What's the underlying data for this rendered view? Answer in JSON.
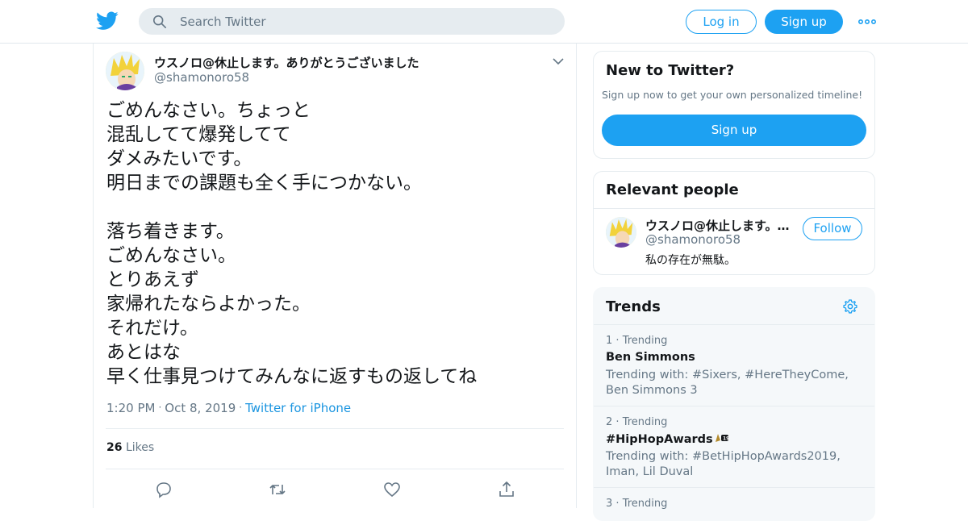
{
  "header": {
    "search_placeholder": "Search Twitter",
    "login_label": "Log in",
    "signup_label": "Sign up",
    "icons": [
      "twitter-logo-icon",
      "search-icon",
      "more-icon"
    ],
    "accent_color": "#1da1f2"
  },
  "tweet": {
    "display_name": "ウスノロ@休止します。ありがとうございました",
    "handle": "@shamonoro58",
    "text": "ごめんなさい。ちょっと\n混乱してて爆発してて\nダメみたいです。\n明日までの課題も全く手につかない。\n\n落ち着きます。\nごめんなさい。\nとりあえず\n家帰れたならよかった。\nそれだけ。\nあとはな\n早く仕事見つけてみんなに返すもの返してね",
    "time": "1:20 PM",
    "date": "Oct 8, 2019",
    "source": "Twitter for iPhone",
    "likes_count": "26",
    "likes_label": "Likes",
    "actions": [
      "reply-icon",
      "retweet-icon",
      "like-icon",
      "share-icon"
    ]
  },
  "new_to_twitter": {
    "title": "New to Twitter?",
    "subtitle": "Sign up now to get your own personalized timeline!",
    "button": "Sign up"
  },
  "relevant_people": {
    "title": "Relevant people",
    "person": {
      "name": "ウスノロ@休止します。ありがとうございました",
      "handle": "@shamonoro58",
      "bio": "私の存在が無駄。",
      "follow_label": "Follow"
    }
  },
  "trends": {
    "title": "Trends",
    "items": [
      {
        "rank": "1",
        "label": "Trending",
        "name": "Ben Simmons",
        "with": "Trending with: #Sixers, #HereTheyCome, Ben Simmons 3"
      },
      {
        "rank": "2",
        "label": "Trending",
        "name": "#HipHopAwards",
        "with": "Trending with: #BetHipHopAwards2019, Iman, Lil Duval"
      },
      {
        "rank": "3",
        "label": "Trending",
        "name": "",
        "with": ""
      }
    ]
  }
}
